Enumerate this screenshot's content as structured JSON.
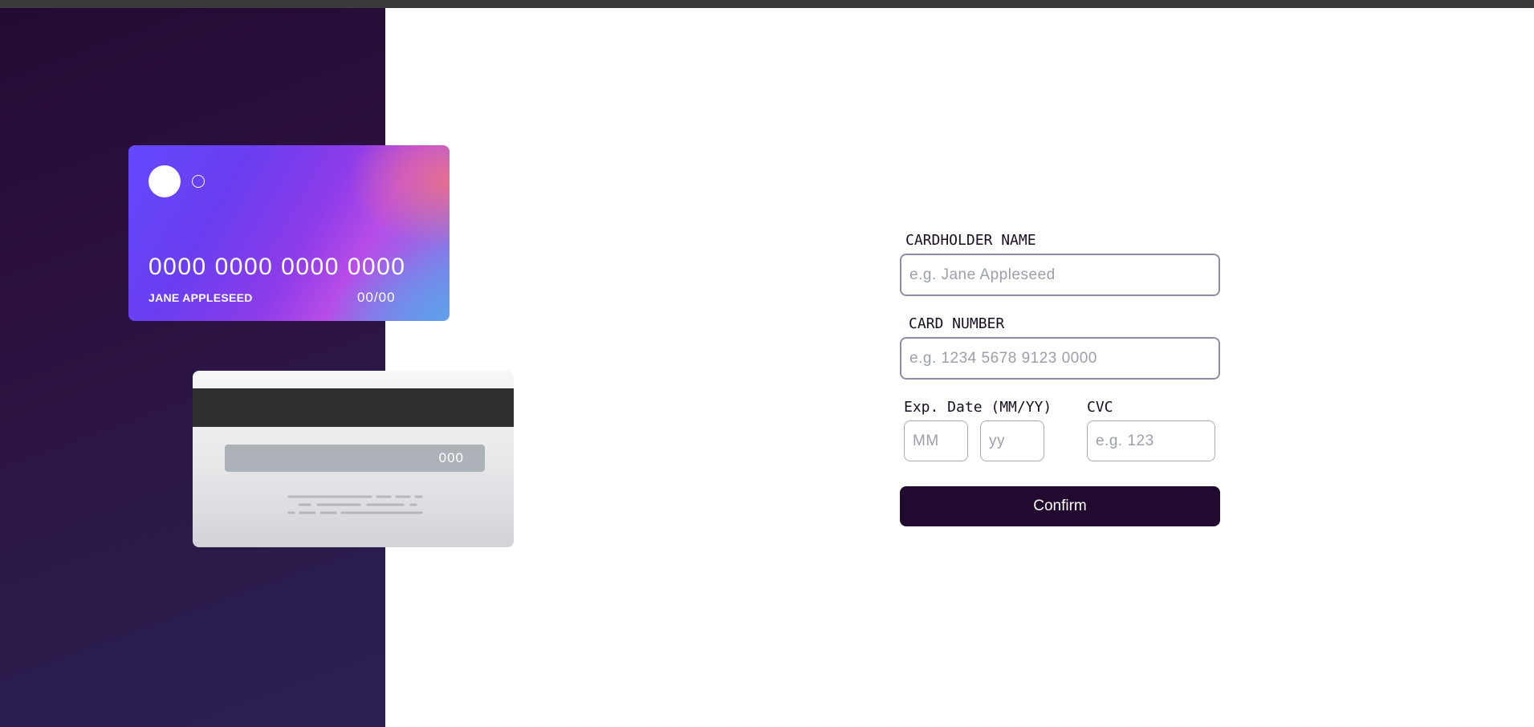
{
  "card_front": {
    "number": "0000 0000 0000 0000",
    "name": "JANE APPLESEED",
    "expiry": "00/00"
  },
  "card_back": {
    "cvc": "000"
  },
  "form": {
    "cardholder_label": "CARDHOLDER NAME",
    "cardholder_placeholder": "e.g. Jane Appleseed",
    "number_label": "CARD NUMBER",
    "number_placeholder": "e.g. 1234 5678 9123 0000",
    "exp_label": "Exp. Date (MM/YY)",
    "exp_month_placeholder": "MM",
    "exp_year_placeholder": "yy",
    "cvc_label": "CVC",
    "cvc_placeholder": "e.g. 123",
    "confirm_label": "Confirm"
  },
  "colors": {
    "sidebar": "#240a32",
    "button": "#21092f",
    "input_border": "#8e8fa6"
  }
}
